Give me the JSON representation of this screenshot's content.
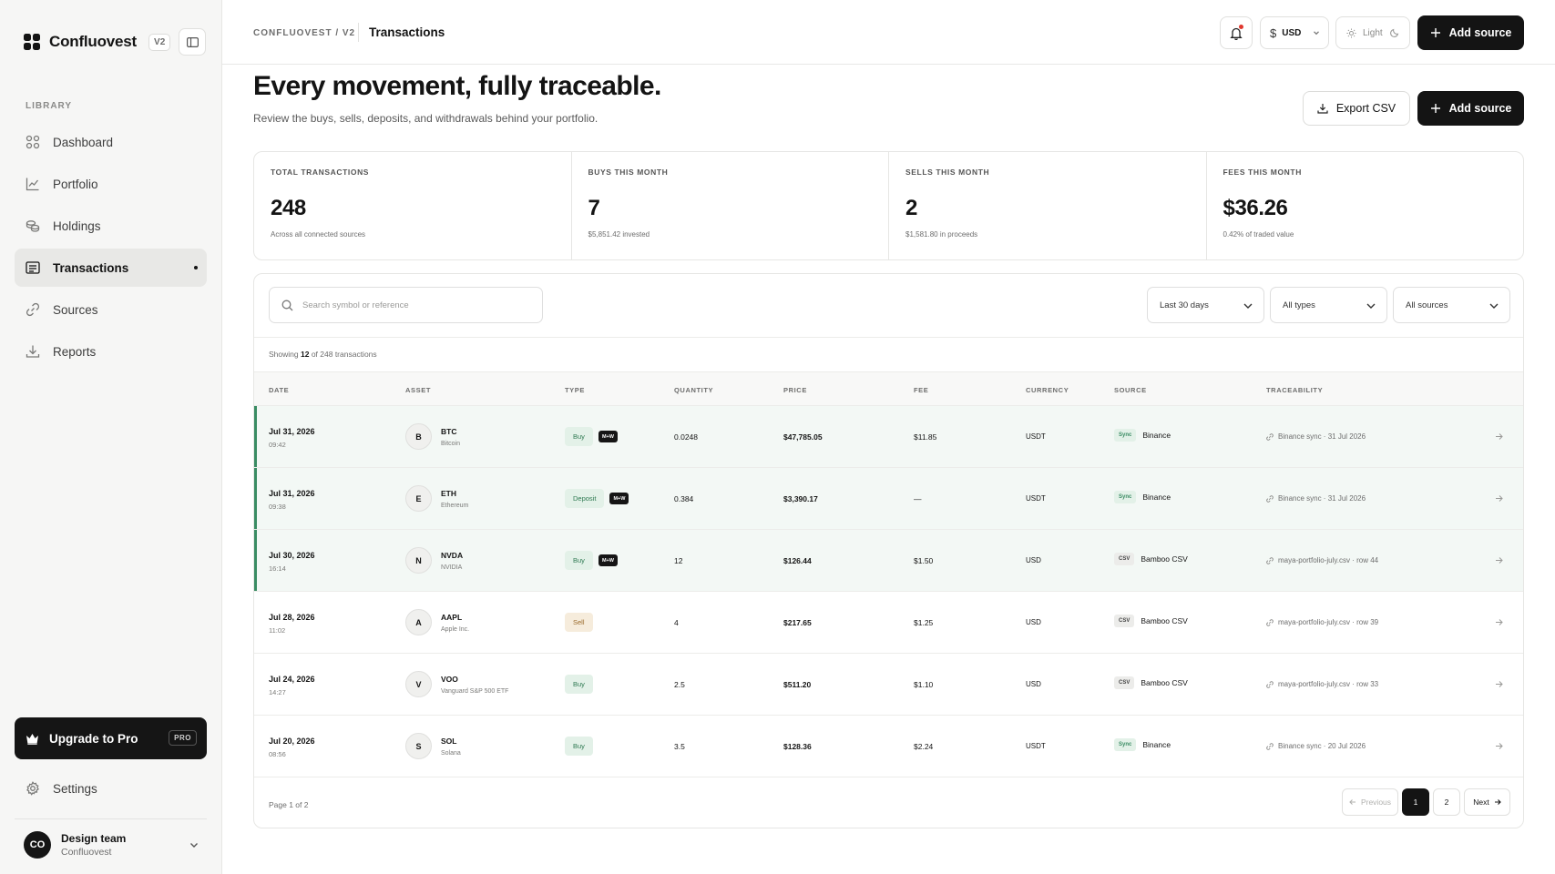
{
  "sidebar": {
    "brand": "Confluovest",
    "version": "V2",
    "section_label": "LIBRARY",
    "items": [
      {
        "label": "Dashboard",
        "icon": "grid-icon"
      },
      {
        "label": "Portfolio",
        "icon": "chart-line-icon"
      },
      {
        "label": "Holdings",
        "icon": "coins-icon"
      },
      {
        "label": "Transactions",
        "icon": "list-icon",
        "active": true
      },
      {
        "label": "Sources",
        "icon": "link-icon"
      },
      {
        "label": "Reports",
        "icon": "download-icon"
      }
    ],
    "upgrade_label": "Upgrade to Pro",
    "pro_badge": "PRO",
    "settings_label": "Settings",
    "account": {
      "initials": "CO",
      "name": "Design team",
      "org": "Confluovest"
    }
  },
  "topbar": {
    "breadcrumb_root": "CONFLUOVEST / V2",
    "breadcrumb_current": "Transactions",
    "currency_symbol": "$",
    "currency": "USD",
    "theme_label": "Light",
    "add_source_label": "Add source"
  },
  "header": {
    "title": "Every movement, fully traceable.",
    "subtitle": "Review the buys, sells, deposits, and withdrawals behind your portfolio.",
    "export_label": "Export CSV",
    "add_source_label": "Add source"
  },
  "stats": [
    {
      "label": "TOTAL TRANSACTIONS",
      "value": "248",
      "note": "Across all connected sources"
    },
    {
      "label": "BUYS THIS MONTH",
      "value": "7",
      "note": "$5,851.42 invested"
    },
    {
      "label": "SELLS THIS MONTH",
      "value": "2",
      "note": "$1,581.80 in proceeds"
    },
    {
      "label": "FEES THIS MONTH",
      "value": "$36.26",
      "note": "0.42% of traded value"
    }
  ],
  "filters": {
    "search_placeholder": "Search symbol or reference",
    "period": "Last 30 days",
    "type": "All types",
    "source": "All sources"
  },
  "showing": {
    "prefix": "Showing",
    "count": "12",
    "suffix": "of 248 transactions"
  },
  "table": {
    "headers": [
      "DATE",
      "ASSET",
      "TYPE",
      "QUANTITY",
      "PRICE",
      "FEE",
      "CURRENCY",
      "SOURCE",
      "TRACEABILITY"
    ],
    "rows": [
      {
        "date": "Jul 31, 2026",
        "time": "09:42",
        "initial": "B",
        "symbol": "BTC",
        "name": "Bitcoin",
        "type": "Buy",
        "type_class": "buy",
        "mw": "M+W",
        "quantity": "0.0248",
        "price": "$47,785.05",
        "fee": "$11.85",
        "currency": "USDT",
        "source_tag": "Sync",
        "source_class": "sync",
        "source": "Binance",
        "trace": "Binance sync · 31 Jul 2026",
        "highlight": true
      },
      {
        "date": "Jul 31, 2026",
        "time": "09:38",
        "initial": "E",
        "symbol": "ETH",
        "name": "Ethereum",
        "type": "Deposit",
        "type_class": "deposit",
        "mw": "M+W",
        "quantity": "0.384",
        "price": "$3,390.17",
        "fee": "—",
        "currency": "USDT",
        "source_tag": "Sync",
        "source_class": "sync",
        "source": "Binance",
        "trace": "Binance sync · 31 Jul 2026",
        "highlight": true
      },
      {
        "date": "Jul 30, 2026",
        "time": "16:14",
        "initial": "N",
        "symbol": "NVDA",
        "name": "NVIDIA",
        "type": "Buy",
        "type_class": "buy",
        "mw": "M+W",
        "quantity": "12",
        "price": "$126.44",
        "fee": "$1.50",
        "currency": "USD",
        "source_tag": "CSV",
        "source_class": "csv",
        "source": "Bamboo CSV",
        "trace": "maya-portfolio-july.csv · row 44",
        "highlight": true
      },
      {
        "date": "Jul 28, 2026",
        "time": "11:02",
        "initial": "A",
        "symbol": "AAPL",
        "name": "Apple Inc.",
        "type": "Sell",
        "type_class": "sell",
        "mw": "",
        "quantity": "4",
        "price": "$217.65",
        "fee": "$1.25",
        "currency": "USD",
        "source_tag": "CSV",
        "source_class": "csv",
        "source": "Bamboo CSV",
        "trace": "maya-portfolio-july.csv · row 39",
        "highlight": false
      },
      {
        "date": "Jul 24, 2026",
        "time": "14:27",
        "initial": "V",
        "symbol": "VOO",
        "name": "Vanguard S&P 500 ETF",
        "type": "Buy",
        "type_class": "buy",
        "mw": "",
        "quantity": "2.5",
        "price": "$511.20",
        "fee": "$1.10",
        "currency": "USD",
        "source_tag": "CSV",
        "source_class": "csv",
        "source": "Bamboo CSV",
        "trace": "maya-portfolio-july.csv · row 33",
        "highlight": false
      },
      {
        "date": "Jul 20, 2026",
        "time": "08:56",
        "initial": "S",
        "symbol": "SOL",
        "name": "Solana",
        "type": "Buy",
        "type_class": "buy",
        "mw": "",
        "quantity": "3.5",
        "price": "$128.36",
        "fee": "$2.24",
        "currency": "USDT",
        "source_tag": "Sync",
        "source_class": "sync",
        "source": "Binance",
        "trace": "Binance sync · 20 Jul 2026",
        "highlight": false
      }
    ]
  },
  "pagination": {
    "info": "Page 1 of 2",
    "prev": "Previous",
    "pages": [
      "1",
      "2"
    ],
    "current": "1",
    "next": "Next"
  },
  "colors": {
    "accent": "#3a8c63",
    "dark": "#141414",
    "notification": "#e0382e"
  }
}
